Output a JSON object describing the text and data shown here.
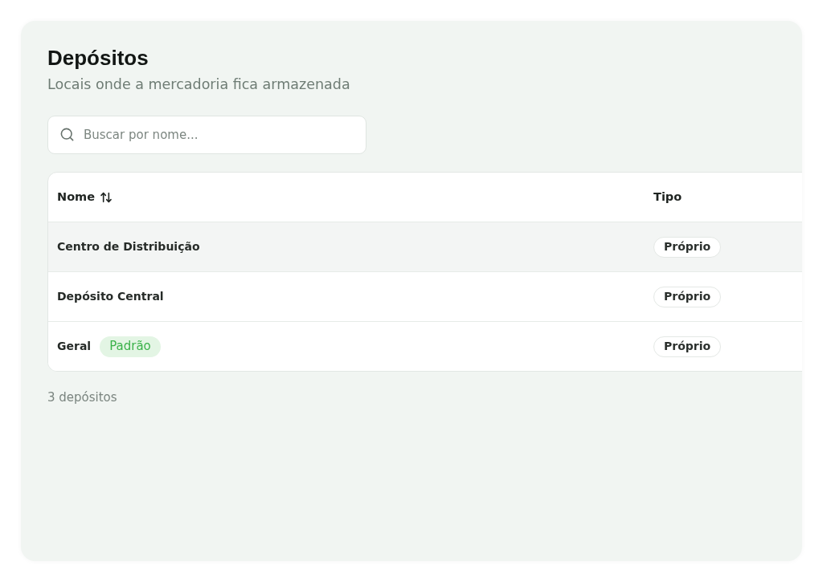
{
  "header": {
    "title": "Depósitos",
    "subtitle": "Locais onde a mercadoria fica armazenada"
  },
  "search": {
    "placeholder": "Buscar por nome..."
  },
  "table": {
    "columns": [
      {
        "label": "Nome",
        "sortable": true
      },
      {
        "label": "Tipo",
        "sortable": false
      }
    ],
    "rows": [
      {
        "name": "Centro de Distribuição",
        "hovered": true,
        "type": "Próprio"
      },
      {
        "name": "Depósito Central",
        "hovered": false,
        "type": "Próprio"
      },
      {
        "name": "Geral",
        "badge": "Padrão",
        "hovered": false,
        "type": "Próprio"
      }
    ]
  },
  "footer": {
    "count": "3 depósitos"
  }
}
